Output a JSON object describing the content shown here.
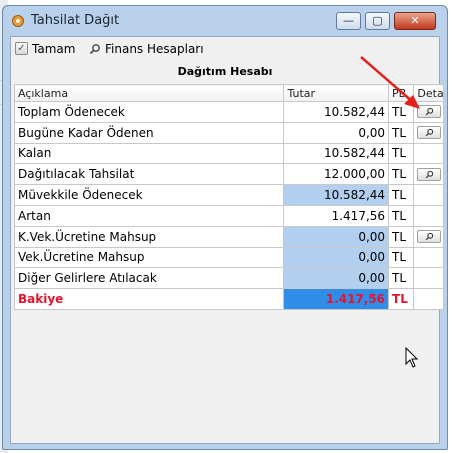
{
  "window": {
    "title": "Tahsilat Dağıt",
    "minimize_glyph": "—",
    "maximize_glyph": "▢",
    "close_glyph": "✕"
  },
  "toolbar": {
    "ok_label": "Tamam",
    "ok_icon": "checkbox-icon",
    "finance_label": "Finans Hesapları",
    "finance_icon": "search-icon"
  },
  "section_title": "Dağıtım Hesabı",
  "table": {
    "headers": [
      "Açıklama",
      "Tutar",
      "PB",
      "Detay"
    ],
    "rows": [
      {
        "label": "Toplam Ödenecek",
        "amount": "10.582,44",
        "currency": "TL",
        "detail": true
      },
      {
        "label": "Bugüne Kadar Ödenen",
        "amount": "0,00",
        "currency": "TL",
        "detail": true
      },
      {
        "label": "Kalan",
        "amount": "10.582,44",
        "currency": "TL",
        "detail": false
      },
      {
        "label": "Dağıtılacak Tahsilat",
        "amount": "12.000,00",
        "currency": "TL",
        "detail": true
      },
      {
        "label": "Müvekkile Ödenecek",
        "amount": "10.582,44",
        "currency": "TL",
        "detail": false
      },
      {
        "label": "Artan",
        "amount": "1.417,56",
        "currency": "TL",
        "detail": false
      },
      {
        "label": "K.Vek.Ücretine Mahsup",
        "amount": "0,00",
        "currency": "TL",
        "detail": true
      },
      {
        "label": "Vek.Ücretine Mahsup",
        "amount": "0,00",
        "currency": "TL",
        "detail": false
      },
      {
        "label": "Diğer Gelirlere Atılacak",
        "amount": "0,00",
        "currency": "TL",
        "detail": false
      },
      {
        "label": "Bakiye",
        "amount": "1.417,56",
        "currency": "TL",
        "detail": false
      }
    ]
  },
  "colors": {
    "highlight_cell": "#b3cff0",
    "selected_cell": "#2f8de8",
    "balance_text": "#e5132d",
    "annotation_arrow": "#e3211c"
  }
}
